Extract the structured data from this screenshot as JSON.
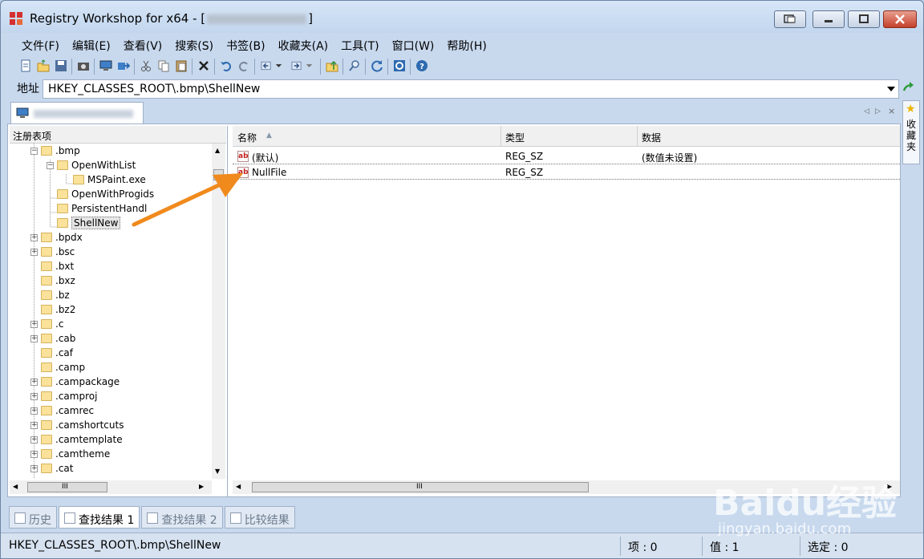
{
  "window": {
    "title_prefix": "Registry Workshop for x64 - [",
    "title_suffix": "]"
  },
  "menu": [
    "文件(F)",
    "编辑(E)",
    "查看(V)",
    "搜索(S)",
    "书签(B)",
    "收藏夹(A)",
    "工具(T)",
    "窗口(W)",
    "帮助(H)"
  ],
  "address": {
    "label": "地址",
    "value": "HKEY_CLASSES_ROOT\\.bmp\\ShellNew"
  },
  "favorites": {
    "label": "收藏夹"
  },
  "tree": {
    "header": "注册表项",
    "items": [
      {
        "label": ".bmp",
        "level": 0,
        "expander": "−"
      },
      {
        "label": "OpenWithList",
        "level": 1,
        "expander": "−"
      },
      {
        "label": "MSPaint.exe",
        "level": 2,
        "expander": ""
      },
      {
        "label": "OpenWithProgids",
        "level": 1,
        "expander": ""
      },
      {
        "label": "PersistentHandl",
        "level": 1,
        "expander": ""
      },
      {
        "label": "ShellNew",
        "level": 1,
        "expander": "",
        "selected": true
      },
      {
        "label": ".bpdx",
        "level": 0,
        "expander": "+"
      },
      {
        "label": ".bsc",
        "level": 0,
        "expander": "+"
      },
      {
        "label": ".bxt",
        "level": 0,
        "expander": ""
      },
      {
        "label": ".bxz",
        "level": 0,
        "expander": ""
      },
      {
        "label": ".bz",
        "level": 0,
        "expander": ""
      },
      {
        "label": ".bz2",
        "level": 0,
        "expander": ""
      },
      {
        "label": ".c",
        "level": 0,
        "expander": "+"
      },
      {
        "label": ".cab",
        "level": 0,
        "expander": "+"
      },
      {
        "label": ".caf",
        "level": 0,
        "expander": ""
      },
      {
        "label": ".camp",
        "level": 0,
        "expander": ""
      },
      {
        "label": ".campackage",
        "level": 0,
        "expander": "+"
      },
      {
        "label": ".camproj",
        "level": 0,
        "expander": "+"
      },
      {
        "label": ".camrec",
        "level": 0,
        "expander": "+"
      },
      {
        "label": ".camshortcuts",
        "level": 0,
        "expander": "+"
      },
      {
        "label": ".camtemplate",
        "level": 0,
        "expander": "+"
      },
      {
        "label": ".camtheme",
        "level": 0,
        "expander": "+"
      },
      {
        "label": ".cat",
        "level": 0,
        "expander": "+"
      }
    ]
  },
  "values": {
    "columns": {
      "name": "名称",
      "type": "类型",
      "data": "数据"
    },
    "rows": [
      {
        "name": "(默认)",
        "type": "REG_SZ",
        "data": "(数值未设置)"
      },
      {
        "name": "NullFile",
        "type": "REG_SZ",
        "data": ""
      }
    ]
  },
  "bottom_tabs": [
    {
      "label": "历史",
      "active": false
    },
    {
      "label": "查找结果 1",
      "active": true
    },
    {
      "label": "查找结果 2",
      "active": false
    },
    {
      "label": "比较结果",
      "active": false
    }
  ],
  "status": {
    "path": "HKEY_CLASSES_ROOT\\.bmp\\ShellNew",
    "items": "项 : 0",
    "values_count": "值 : 1",
    "selected": "选定 : 0"
  },
  "scrollbar": {
    "h_mark": "III"
  },
  "watermark": {
    "big": "Baidu经验",
    "small": "jingyan.baidu.com"
  },
  "icons": {
    "app": "registry-icon",
    "go": "go-arrow-icon",
    "value_type": "string-value-icon",
    "annotation": "orange-arrow"
  },
  "colors": {
    "annotation_arrow": "#f08a1c",
    "value_icon_text": "#c21f1f"
  }
}
